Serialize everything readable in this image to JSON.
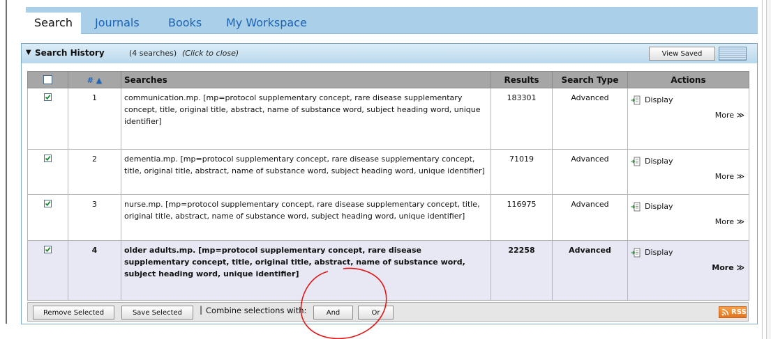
{
  "tabs": [
    {
      "label": "Search"
    },
    {
      "label": "Journals"
    },
    {
      "label": "Books"
    },
    {
      "label": "My Workspace"
    }
  ],
  "history": {
    "title": "Search History",
    "count": "(4 searches)",
    "click_hint": "(Click to close)",
    "view_saved": "View Saved"
  },
  "columns": {
    "num": "# ▲",
    "searches": "Searches",
    "results": "Results",
    "search_type": "Search Type",
    "actions": "Actions"
  },
  "rows": [
    {
      "num": "1",
      "query": "communication.mp. [mp=protocol supplementary concept, rare disease supplementary concept, title, original title, abstract, name of substance word, subject heading word, unique identifier]",
      "results": "183301",
      "type": "Advanced",
      "display": "Display",
      "more": "More ≫",
      "checked": true
    },
    {
      "num": "2",
      "query": "dementia.mp. [mp=protocol supplementary concept, rare disease supplementary concept, title, original title, abstract, name of substance word, subject heading word, unique identifier]",
      "results": "71019",
      "type": "Advanced",
      "display": "Display",
      "more": "More ≫",
      "checked": true
    },
    {
      "num": "3",
      "query": "nurse.mp. [mp=protocol supplementary concept, rare disease supplementary concept, title, original title, abstract, name of substance word, subject heading word, unique identifier]",
      "results": "116975",
      "type": "Advanced",
      "display": "Display",
      "more": "More ≫",
      "checked": true
    },
    {
      "num": "4",
      "query": "older adults.mp. [mp=protocol supplementary concept, rare disease supplementary concept, title, original title, abstract, name of substance word, subject heading word, unique identifier]",
      "results": "22258",
      "type": "Advanced",
      "display": "Display",
      "more": "More ≫",
      "checked": true
    }
  ],
  "bottom": {
    "remove_selected": "Remove Selected",
    "save_selected": "Save Selected",
    "separator": "|",
    "combine_label": "Combine selections with:",
    "and": "And",
    "or": "Or",
    "rss": "RSS"
  },
  "colors": {
    "tab_bar": "#a9d0e8",
    "link": "#1c63b5",
    "annotation_circle": "#e01515",
    "rss": "#e3731f"
  }
}
